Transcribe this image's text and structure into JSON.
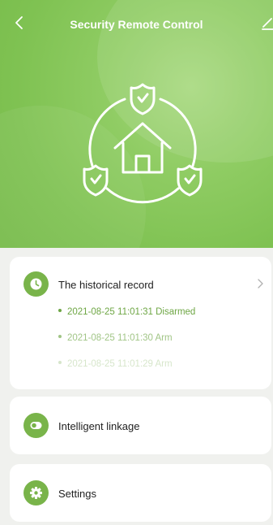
{
  "header": {
    "title": "Security Remote Control",
    "back_icon": "chevron-left-icon",
    "edit_icon": "pencil-icon"
  },
  "hero": {
    "illustration": "house-with-three-shields",
    "colors": {
      "top": "#a6d87d",
      "bottom": "#77bb4a"
    }
  },
  "history": {
    "label": "The historical record",
    "icon": "clock-icon",
    "records": [
      {
        "text": "2021-08-25 11:01:31 Disarmed"
      },
      {
        "text": "2021-08-25 11:01:30 Arm"
      },
      {
        "text": "2021-08-25 11:01:29 Arm"
      }
    ]
  },
  "linkage": {
    "label": "Intelligent linkage",
    "icon": "toggle-icon"
  },
  "settings": {
    "label": "Settings",
    "icon": "gear-icon"
  },
  "colors": {
    "accent": "#79b44a",
    "record_text": "#6ea644",
    "background": "#f0f1ee"
  }
}
